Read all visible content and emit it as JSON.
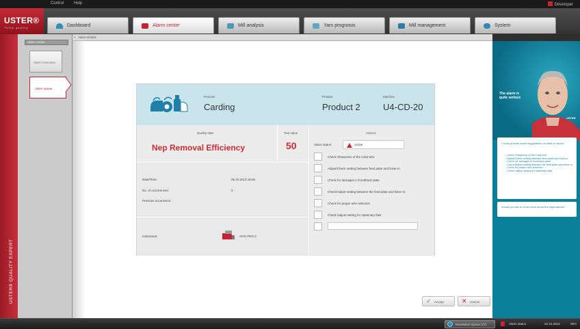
{
  "menu": {
    "items": [
      "Control",
      "Help"
    ],
    "user": "Developer"
  },
  "brand": {
    "name": "USTER®",
    "tagline": "Think quality"
  },
  "nav": {
    "tabs": [
      {
        "label": "Dashboard",
        "active": false,
        "icon": "gauge-icon"
      },
      {
        "label": "Alarm center",
        "active": true,
        "icon": "alarm-icon"
      },
      {
        "label": "Mill analysis",
        "active": false,
        "icon": "mill-icon"
      },
      {
        "label": "Yarn prognosis",
        "active": false,
        "icon": "yarn-icon"
      },
      {
        "label": "Mill management",
        "active": false,
        "icon": "management-icon"
      },
      {
        "label": "System",
        "active": false,
        "icon": "system-icon"
      }
    ]
  },
  "rail": {
    "label": "USTER® QUALITY EXPERT"
  },
  "sidebar": {
    "header": "Alarm center",
    "items": [
      {
        "label": "Alarm Overview",
        "active": false
      },
      {
        "label": "Alarm queue",
        "active": true
      }
    ]
  },
  "breadcrumb": {
    "close": "×",
    "label": "Alarm Details"
  },
  "alarm": {
    "process_label": "Process",
    "process": "Carding",
    "product_label": "Product",
    "product": "Product 2",
    "machine_label": "Machine",
    "machine": "U4-CD-20",
    "quality_label": "Quality data",
    "quality": "Nep Removal Efficiency",
    "test_value_label": "Test value",
    "test_value": "50",
    "details": [
      {
        "key": "Date/Time:",
        "value": "05.10.2013 15:06"
      },
      {
        "key": "No. of occurrences:",
        "value": "0"
      },
      {
        "key": "Previous occurrence:",
        "value": ""
      }
    ],
    "instrument_label": "Instrument:",
    "instrument": "AFIS PRO 2",
    "actions_label": "Actions",
    "status_label": "Alarm status:",
    "status_value": "Active",
    "checks": [
      "Check Sharpness of the Card wire",
      "Adjust/Check setting between feed plate and licker-in",
      "Check for damages in front/back plate",
      "Check/Adjust setting between the feed plate and licker-in",
      "Check for proper wire selection",
      "Check /adjust setting for stationary flats",
      "Other"
    ],
    "accept_label": "Accept",
    "cancel_label": "Cancel"
  },
  "coach": {
    "bubble": "The alarm is quite serious",
    "brand": "USTER",
    "question": "I could provide some suggestions on what to check!",
    "tips": [
      "- Check Sharpness of the Card wire",
      "- Adjust/Check setting between feed plate and licker-in",
      "- Check for damages in front/back plate",
      "- Check/Adjust setting between the feed plate and licker-in",
      "- Check for proper wire selection",
      "- Check /adjust setting for stationary flats"
    ],
    "more": "Would you like to know more about the implications?"
  },
  "statusbar": {
    "queue": "Resolution Queue (17)",
    "alarm": "Alarm status",
    "date": "22.10.2013",
    "time": "08:0"
  },
  "colors": {
    "brand_red": "#c52233",
    "coach_teal": "#0a7f9c",
    "header_blue": "#c9e4ea"
  }
}
